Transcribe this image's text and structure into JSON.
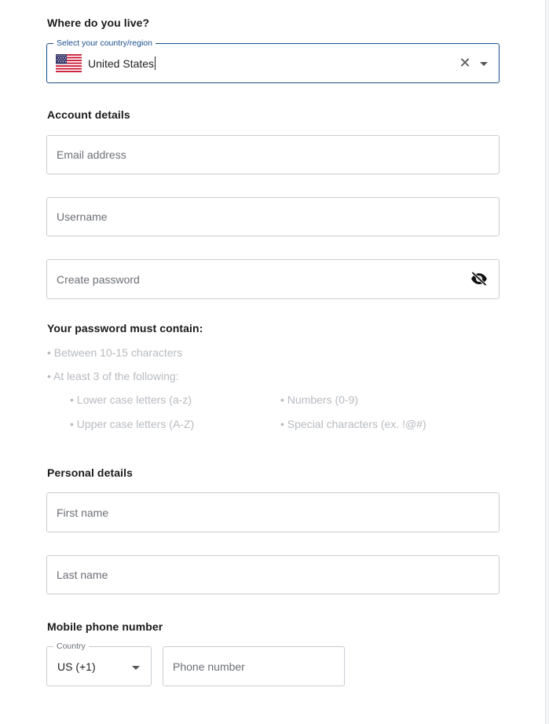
{
  "location": {
    "heading": "Where do you live?",
    "country_label": "Select your country/region",
    "country_value": "United States",
    "flag_icon": "us-flag-icon"
  },
  "account": {
    "heading": "Account details",
    "email_placeholder": "Email address",
    "username_placeholder": "Username",
    "password_placeholder": "Create password",
    "password_toggle_icon": "eye-slash-icon"
  },
  "password_rules": {
    "heading": "Your password must contain:",
    "items": [
      "• Between 10-15 characters",
      "• At least 3 of the following:"
    ],
    "sub_items": [
      "• Lower case letters (a-z)",
      "• Numbers (0-9)",
      "• Upper case letters (A-Z)",
      "• Special characters (ex. !@#)"
    ],
    "color": "#b7bbc0"
  },
  "personal": {
    "heading": "Personal details",
    "first_name_placeholder": "First name",
    "last_name_placeholder": "Last name"
  },
  "phone": {
    "heading": "Mobile phone number",
    "country_label": "Country",
    "country_value": "US (+1)",
    "number_placeholder": "Phone number"
  },
  "colors": {
    "focus_border": "#1a4f8b",
    "border": "#c9cdd2",
    "placeholder": "#6b6f75"
  }
}
